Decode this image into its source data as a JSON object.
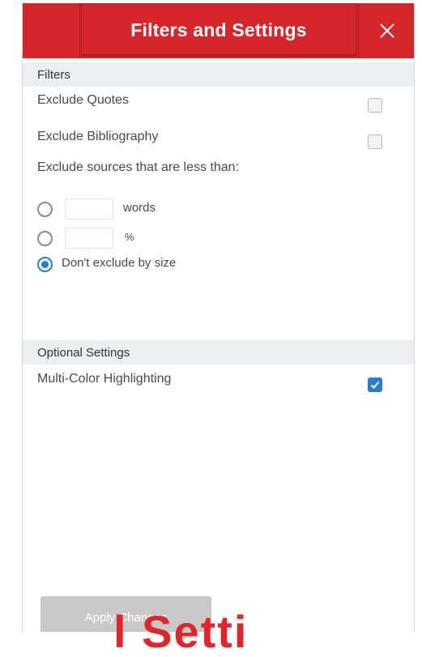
{
  "header": {
    "title": "Filters and Settings",
    "close_icon": "close-icon"
  },
  "filters": {
    "section_label": "Filters",
    "exclude_quotes": {
      "label": "Exclude Quotes",
      "checked": false
    },
    "exclude_bibliography": {
      "label": "Exclude Bibliography",
      "checked": false
    },
    "exclude_small_label": "Exclude sources that are less than:",
    "size_options": [
      {
        "unit": "words",
        "value": "",
        "selected": false
      },
      {
        "unit": "%",
        "value": "",
        "selected": false
      },
      {
        "label": "Don't exclude by size",
        "selected": true
      }
    ]
  },
  "optional": {
    "section_label": "Optional Settings",
    "multi_color": {
      "label": "Multi-Color Highlighting",
      "checked": true
    }
  },
  "footer": {
    "apply_label": "Apply Changes"
  },
  "background_text": "l Setti",
  "colors": {
    "header_red": "#d7262b",
    "accent_blue": "#2a7dcc",
    "section_bg": "#eceff2",
    "button_disabled": "#c9c9c9"
  }
}
